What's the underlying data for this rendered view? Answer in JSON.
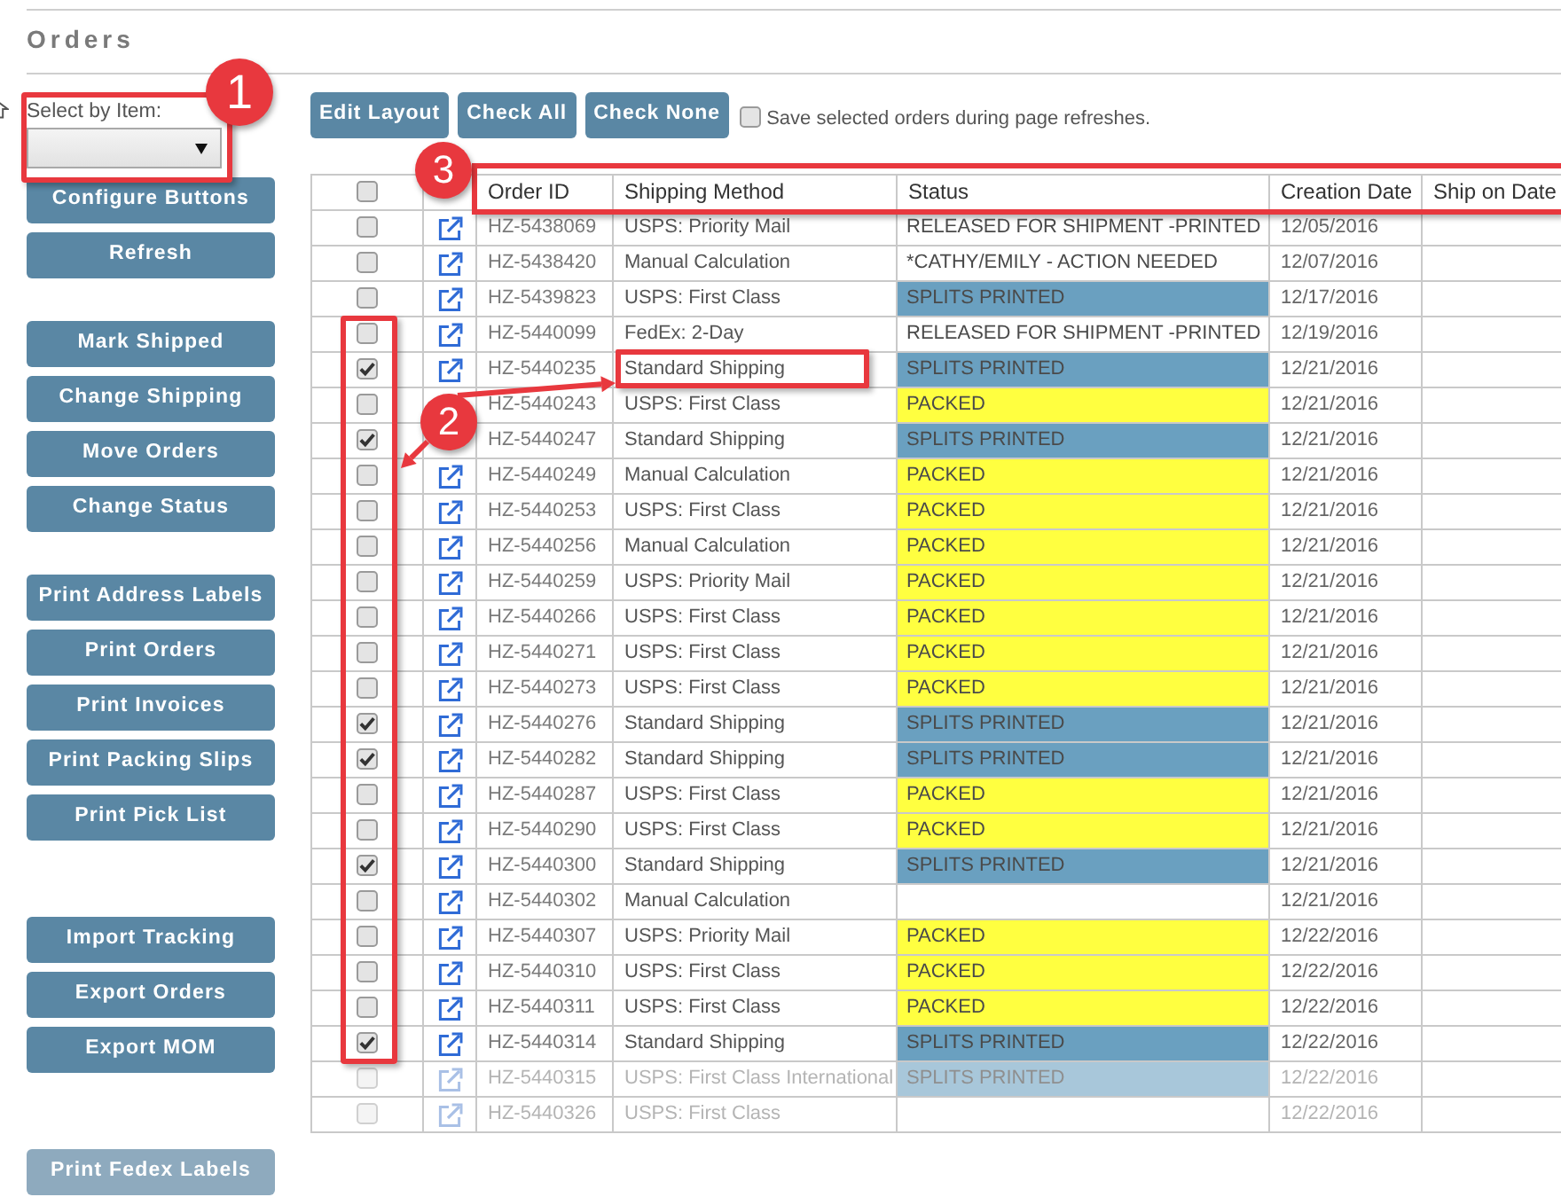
{
  "page": {
    "title": "Orders"
  },
  "sidebar": {
    "select": {
      "label": "Select by Item:"
    },
    "button_groups": [
      [
        {
          "label": "Configure Buttons",
          "faded": false
        },
        {
          "label": "Refresh",
          "faded": false
        }
      ],
      [
        {
          "label": "Mark Shipped",
          "faded": false
        },
        {
          "label": "Change Shipping",
          "faded": false
        },
        {
          "label": "Move Orders",
          "faded": false
        },
        {
          "label": "Change Status",
          "faded": false
        }
      ],
      [
        {
          "label": "Print Address Labels",
          "faded": false
        },
        {
          "label": "Print Orders",
          "faded": false
        },
        {
          "label": "Print Invoices",
          "faded": false
        },
        {
          "label": "Print Packing Slips",
          "faded": false
        },
        {
          "label": "Print Pick List",
          "faded": false
        }
      ],
      [
        {
          "label": "Import Tracking",
          "faded": false
        },
        {
          "label": "Export Orders",
          "faded": false
        },
        {
          "label": "Export MOM",
          "faded": false
        }
      ],
      [
        {
          "label": "Print Fedex Labels",
          "faded": true
        }
      ]
    ]
  },
  "toolbar": {
    "buttons": [
      "Edit Layout",
      "Check All",
      "Check None"
    ],
    "save_selected": {
      "label": "Save selected orders during page refreshes.",
      "checked": false
    }
  },
  "table": {
    "select_all_checked": false,
    "columns": [
      "Order ID",
      "Shipping Method",
      "Status",
      "Creation Date",
      "Ship on Date"
    ],
    "rows": [
      {
        "checked": false,
        "faded": false,
        "order_id": "HZ-5438069",
        "shipping_method": "USPS: Priority Mail",
        "status": {
          "text": "RELEASED FOR SHIPMENT -PRINTED"
        },
        "creation_date": "12/05/2016"
      },
      {
        "checked": false,
        "faded": false,
        "order_id": "HZ-5438420",
        "shipping_method": "Manual Calculation",
        "status": {
          "text": "*CATHY/EMILY - ACTION NEEDED"
        },
        "creation_date": "12/07/2016"
      },
      {
        "checked": false,
        "faded": false,
        "order_id": "HZ-5439823",
        "shipping_method": "USPS: First Class",
        "status": {
          "text": "SPLITS PRINTED",
          "color": "#6aa0c0"
        },
        "creation_date": "12/17/2016"
      },
      {
        "checked": false,
        "faded": false,
        "order_id": "HZ-5440099",
        "shipping_method": "FedEx: 2-Day",
        "status": {
          "text": "RELEASED FOR SHIPMENT -PRINTED"
        },
        "creation_date": "12/19/2016"
      },
      {
        "checked": true,
        "faded": false,
        "order_id": "HZ-5440235",
        "shipping_method": "Standard Shipping",
        "status": {
          "text": "SPLITS PRINTED",
          "color": "#6aa0c0"
        },
        "creation_date": "12/21/2016"
      },
      {
        "checked": false,
        "faded": false,
        "order_id": "HZ-5440243",
        "shipping_method": "USPS: First Class",
        "status": {
          "text": "PACKED",
          "color": "#ffff40"
        },
        "creation_date": "12/21/2016"
      },
      {
        "checked": true,
        "faded": false,
        "order_id": "HZ-5440247",
        "shipping_method": "Standard Shipping",
        "status": {
          "text": "SPLITS PRINTED",
          "color": "#6aa0c0"
        },
        "creation_date": "12/21/2016"
      },
      {
        "checked": false,
        "faded": false,
        "order_id": "HZ-5440249",
        "shipping_method": "Manual Calculation",
        "status": {
          "text": "PACKED",
          "color": "#ffff40"
        },
        "creation_date": "12/21/2016"
      },
      {
        "checked": false,
        "faded": false,
        "order_id": "HZ-5440253",
        "shipping_method": "USPS: First Class",
        "status": {
          "text": "PACKED",
          "color": "#ffff40"
        },
        "creation_date": "12/21/2016"
      },
      {
        "checked": false,
        "faded": false,
        "order_id": "HZ-5440256",
        "shipping_method": "Manual Calculation",
        "status": {
          "text": "PACKED",
          "color": "#ffff40"
        },
        "creation_date": "12/21/2016"
      },
      {
        "checked": false,
        "faded": false,
        "order_id": "HZ-5440259",
        "shipping_method": "USPS: Priority Mail",
        "status": {
          "text": "PACKED",
          "color": "#ffff40"
        },
        "creation_date": "12/21/2016"
      },
      {
        "checked": false,
        "faded": false,
        "order_id": "HZ-5440266",
        "shipping_method": "USPS: First Class",
        "status": {
          "text": "PACKED",
          "color": "#ffff40"
        },
        "creation_date": "12/21/2016"
      },
      {
        "checked": false,
        "faded": false,
        "order_id": "HZ-5440271",
        "shipping_method": "USPS: First Class",
        "status": {
          "text": "PACKED",
          "color": "#ffff40"
        },
        "creation_date": "12/21/2016"
      },
      {
        "checked": false,
        "faded": false,
        "order_id": "HZ-5440273",
        "shipping_method": "USPS: First Class",
        "status": {
          "text": "PACKED",
          "color": "#ffff40"
        },
        "creation_date": "12/21/2016"
      },
      {
        "checked": true,
        "faded": false,
        "order_id": "HZ-5440276",
        "shipping_method": "Standard Shipping",
        "status": {
          "text": "SPLITS PRINTED",
          "color": "#6aa0c0"
        },
        "creation_date": "12/21/2016"
      },
      {
        "checked": true,
        "faded": false,
        "order_id": "HZ-5440282",
        "shipping_method": "Standard Shipping",
        "status": {
          "text": "SPLITS PRINTED",
          "color": "#6aa0c0"
        },
        "creation_date": "12/21/2016"
      },
      {
        "checked": false,
        "faded": false,
        "order_id": "HZ-5440287",
        "shipping_method": "USPS: First Class",
        "status": {
          "text": "PACKED",
          "color": "#ffff40"
        },
        "creation_date": "12/21/2016"
      },
      {
        "checked": false,
        "faded": false,
        "order_id": "HZ-5440290",
        "shipping_method": "USPS: First Class",
        "status": {
          "text": "PACKED",
          "color": "#ffff40"
        },
        "creation_date": "12/21/2016"
      },
      {
        "checked": true,
        "faded": false,
        "order_id": "HZ-5440300",
        "shipping_method": "Standard Shipping",
        "status": {
          "text": "SPLITS PRINTED",
          "color": "#6aa0c0"
        },
        "creation_date": "12/21/2016"
      },
      {
        "checked": false,
        "faded": false,
        "order_id": "HZ-5440302",
        "shipping_method": "Manual Calculation",
        "creation_date": "12/21/2016"
      },
      {
        "checked": false,
        "faded": false,
        "order_id": "HZ-5440307",
        "shipping_method": "USPS: Priority Mail",
        "status": {
          "text": "PACKED",
          "color": "#ffff40"
        },
        "creation_date": "12/22/2016"
      },
      {
        "checked": false,
        "faded": false,
        "order_id": "HZ-5440310",
        "shipping_method": "USPS: First Class",
        "status": {
          "text": "PACKED",
          "color": "#ffff40"
        },
        "creation_date": "12/22/2016"
      },
      {
        "checked": false,
        "faded": false,
        "order_id": "HZ-5440311",
        "shipping_method": "USPS: First Class",
        "status": {
          "text": "PACKED",
          "color": "#ffff40"
        },
        "creation_date": "12/22/2016"
      },
      {
        "checked": true,
        "faded": false,
        "order_id": "HZ-5440314",
        "shipping_method": "Standard Shipping",
        "status": {
          "text": "SPLITS PRINTED",
          "color": "#6aa0c0"
        },
        "creation_date": "12/22/2016"
      },
      {
        "checked": false,
        "faded": true,
        "order_id": "HZ-5440315",
        "shipping_method": "USPS: First Class International",
        "status": {
          "text": "SPLITS PRINTED",
          "color": "#a8c7da"
        },
        "creation_date": "12/22/2016"
      },
      {
        "checked": false,
        "faded": true,
        "order_id": "HZ-5440326",
        "shipping_method": "USPS: First Class",
        "creation_date": "12/22/2016"
      }
    ]
  },
  "callouts": [
    {
      "number": "1"
    },
    {
      "number": "2"
    },
    {
      "number": "3"
    }
  ]
}
